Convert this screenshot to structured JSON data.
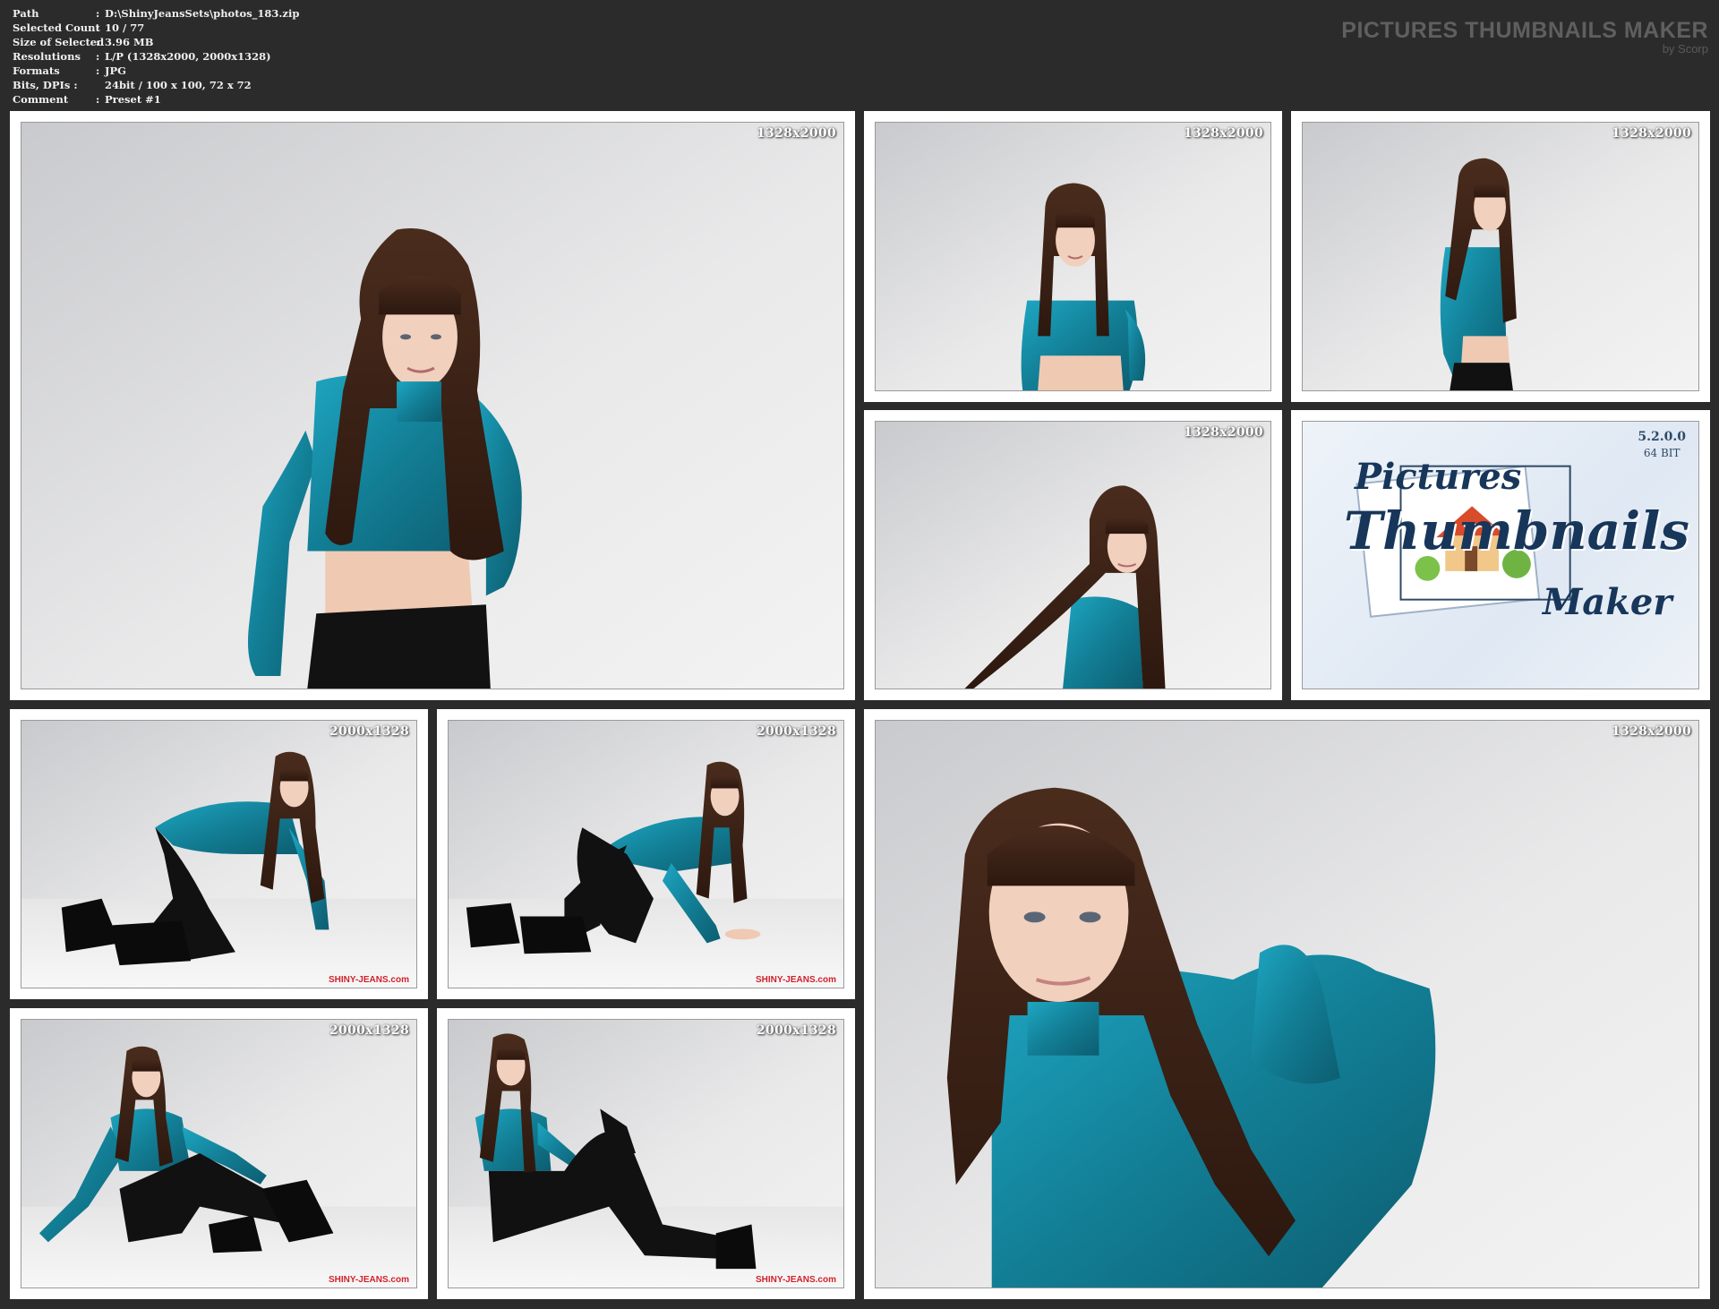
{
  "info": {
    "rows": [
      {
        "label": "Path",
        "value": "D:\\ShinyJeansSets\\photos_183.zip"
      },
      {
        "label": "Selected Count",
        "value": "10 / 77"
      },
      {
        "label": "Size of Selected",
        "value": "3.96 MB"
      },
      {
        "label": "Resolutions",
        "value": "L/P (1328x2000, 2000x1328)"
      },
      {
        "label": "Formats",
        "value": "JPG"
      },
      {
        "label": "Bits, DPIs :",
        "value": "24bit / 100 x 100, 72 x 72"
      },
      {
        "label": "Comment",
        "value": "Preset #1"
      }
    ],
    "separator": ":",
    "separator_bits": ""
  },
  "brand": {
    "title": "PICTURES THUMBNAILS MAKER",
    "by": "by Scorp"
  },
  "thumbnails": [
    {
      "resolution": "1328x2000",
      "watermark": ""
    },
    {
      "resolution": "1328x2000",
      "watermark": ""
    },
    {
      "resolution": "1328x2000",
      "watermark": ""
    },
    {
      "resolution": "1328x2000",
      "watermark": ""
    },
    {
      "resolution": "2000x1328",
      "watermark": "SHINY-JEANS.com"
    },
    {
      "resolution": "2000x1328",
      "watermark": "SHINY-JEANS.com"
    },
    {
      "resolution": "1328x2000",
      "watermark": ""
    },
    {
      "resolution": "2000x1328",
      "watermark": "SHINY-JEANS.com"
    },
    {
      "resolution": "2000x1328",
      "watermark": "SHINY-JEANS.com"
    }
  ],
  "logo": {
    "version": "5.2.0.0",
    "bits": "64 BIT",
    "word1": "Pictures",
    "word2": "Thumbnails",
    "word3": "Maker"
  },
  "colors": {
    "background": "#2b2b2b",
    "tile": "#ffffff",
    "top_color": "#1a8fa8",
    "hair_color": "#3d2418",
    "pants_color": "#111111",
    "logo_text": "#17365a",
    "watermark_red": "#d0202a"
  }
}
